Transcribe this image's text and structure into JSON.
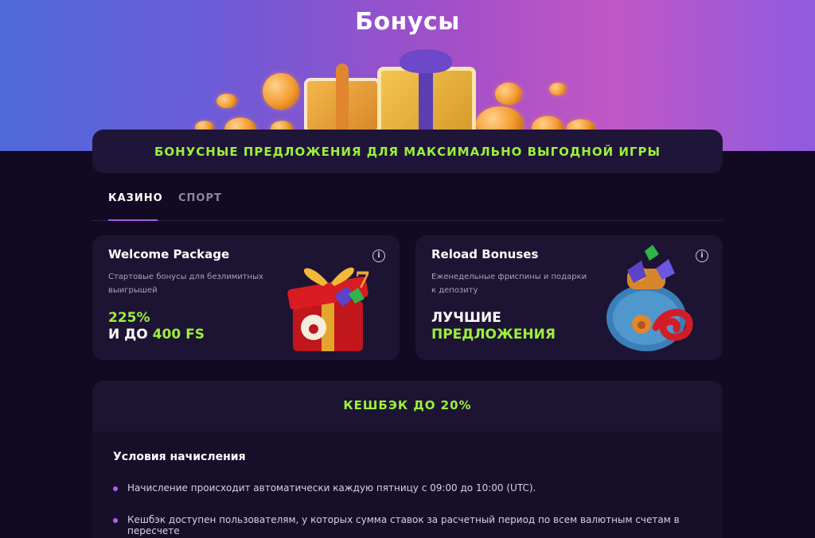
{
  "page_title": "Бонусы",
  "banner_text": "БОНУСНЫЕ ПРЕДЛОЖЕНИЯ ДЛЯ МАКСИМАЛЬНО ВЫГОДНОЙ ИГРЫ",
  "tabs": [
    {
      "label": "КАЗИНО",
      "active": true
    },
    {
      "label": "СПОРТ",
      "active": false
    }
  ],
  "cards": [
    {
      "title": "Welcome Package",
      "description": "Стартовые бонусы для безлимитных выигрышей",
      "line1": "225%",
      "line2_prefix": "И ДО ",
      "line2_highlight": "400 FS",
      "art_icon": "gift-box-icon"
    },
    {
      "title": "Reload Bonuses",
      "description": "Еженедельные фриспины и подарки к депозиту",
      "line1": "ЛУЧШИЕ",
      "line2_highlight": "ПРЕДЛОЖЕНИЯ",
      "art_icon": "treasure-bag-icon"
    }
  ],
  "cashback": {
    "title": "КЕШБЭК ДО 20%",
    "conditions_title": "Условия начисления",
    "conditions": [
      "Начисление происходит автоматически каждую пятницу с 09:00 до 10:00 (UTC).",
      "Кешбэк доступен пользователям, у которых сумма ставок за расчетный период по всем валютным счетам в пересчете"
    ]
  },
  "colors": {
    "accent_green": "#9bf03a",
    "accent_purple": "#a65ce6",
    "background": "#120a22",
    "card": "#1d1433"
  }
}
